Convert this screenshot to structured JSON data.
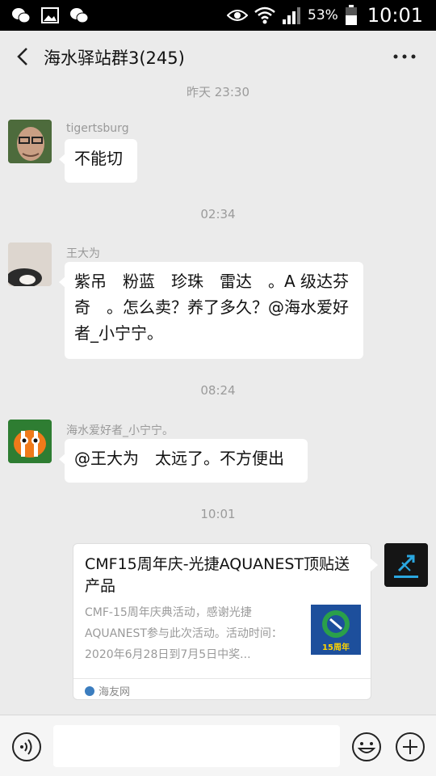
{
  "status_bar": {
    "battery": "53%",
    "time": "10:01"
  },
  "header": {
    "title": "海水驿站群3(245)"
  },
  "messages": [
    {
      "timestamp": "昨天 23:30",
      "sender": "tigertsburg",
      "text": "不能切"
    },
    {
      "timestamp": "02:34",
      "sender": "王大为",
      "text": "紫吊　粉蓝　珍珠　雷达　。A 级达芬奇　。怎么卖？养了多久？@海水爱好者_小宁宁。"
    },
    {
      "timestamp": "08:24",
      "sender": "海水爱好者_小宁宁。",
      "text": "@王大为　太远了。不方便出"
    },
    {
      "timestamp": "10:01"
    }
  ],
  "card": {
    "title": "CMF15周年庆-光捷AQUANEST顶贴送产品",
    "description": "CMF-15周年庆典活动，感谢光捷AQUANEST参与此次活动。活动时间：2020年6月28日到7月5日中奖...",
    "thumb_text": "15周年",
    "source": "海友网"
  },
  "input": {
    "placeholder": ""
  },
  "colors": {
    "background": "#ebebeb",
    "bubble": "#ffffff",
    "status_bar": "#000000"
  },
  "icons": [
    "wechat-icon",
    "image-icon",
    "eye-icon",
    "wifi-icon",
    "signal-icon",
    "battery-icon",
    "back-icon",
    "more-icon",
    "voice-icon",
    "emoji-icon",
    "plus-icon"
  ]
}
